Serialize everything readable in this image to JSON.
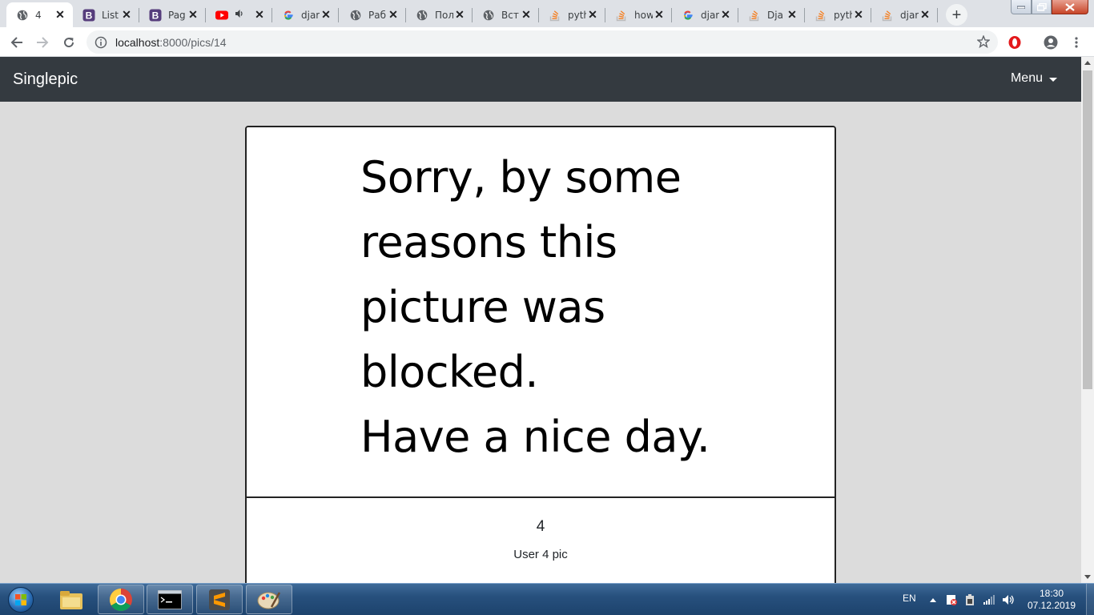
{
  "browser": {
    "tabs": [
      {
        "label": "4",
        "icon": "globe-icon",
        "active": true
      },
      {
        "label": "List",
        "icon": "bootstrap-icon"
      },
      {
        "label": "Pag",
        "icon": "bootstrap-icon"
      },
      {
        "label": "",
        "icon": "youtube-icon"
      },
      {
        "label": "djar",
        "icon": "google-icon"
      },
      {
        "label": "Раб",
        "icon": "globe-icon"
      },
      {
        "label": "Пол",
        "icon": "globe-icon"
      },
      {
        "label": "Вст",
        "icon": "globe-icon"
      },
      {
        "label": "pyth",
        "icon": "stackoverflow-icon"
      },
      {
        "label": "how",
        "icon": "stackoverflow-icon"
      },
      {
        "label": "djar",
        "icon": "google-icon"
      },
      {
        "label": "Dja",
        "icon": "stackoverflow-icon"
      },
      {
        "label": "pyth",
        "icon": "stackoverflow-icon"
      },
      {
        "label": "djar",
        "icon": "stackoverflow-icon"
      }
    ],
    "url_host": "localhost",
    "url_path": ":8000/pics/14"
  },
  "navbar": {
    "brand": "Singlepic",
    "menu_label": "Menu"
  },
  "card": {
    "image_lines": [
      "Sorry, by some",
      "reasons this",
      "picture was",
      "blocked.",
      "Have a nice day."
    ],
    "title": "4",
    "text": "User 4 pic"
  },
  "taskbar": {
    "language": "EN",
    "time": "18:30",
    "date": "07.12.2019"
  },
  "colors": {
    "navbar_bg": "#343a40",
    "page_bg": "#dcdcdc",
    "card_border": "#232323"
  }
}
